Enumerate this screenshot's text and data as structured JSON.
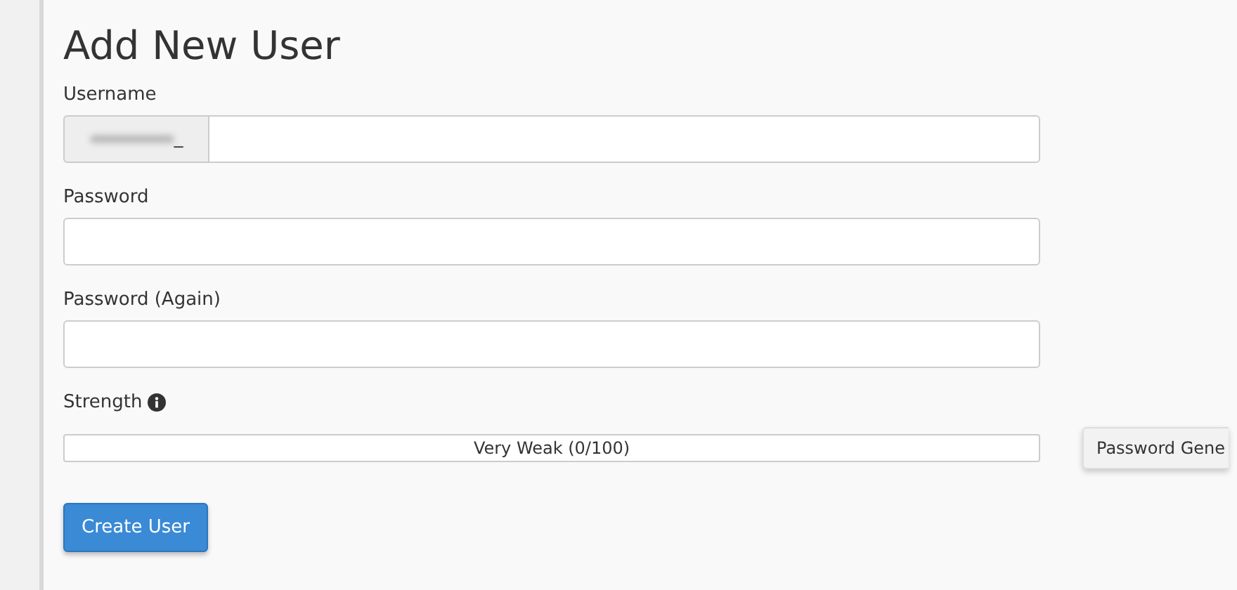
{
  "title": "Add New User",
  "fields": [
    {
      "label": "Username",
      "prefix": "_",
      "redacted_prefix": true
    },
    {
      "label": "Password"
    },
    {
      "label": "Password (Again)"
    }
  ],
  "strength": {
    "label": "Strength",
    "level": 0,
    "reading": "Very Weak (0/100)"
  },
  "generator_button": "Password Gene",
  "submit_button": "Create User"
}
